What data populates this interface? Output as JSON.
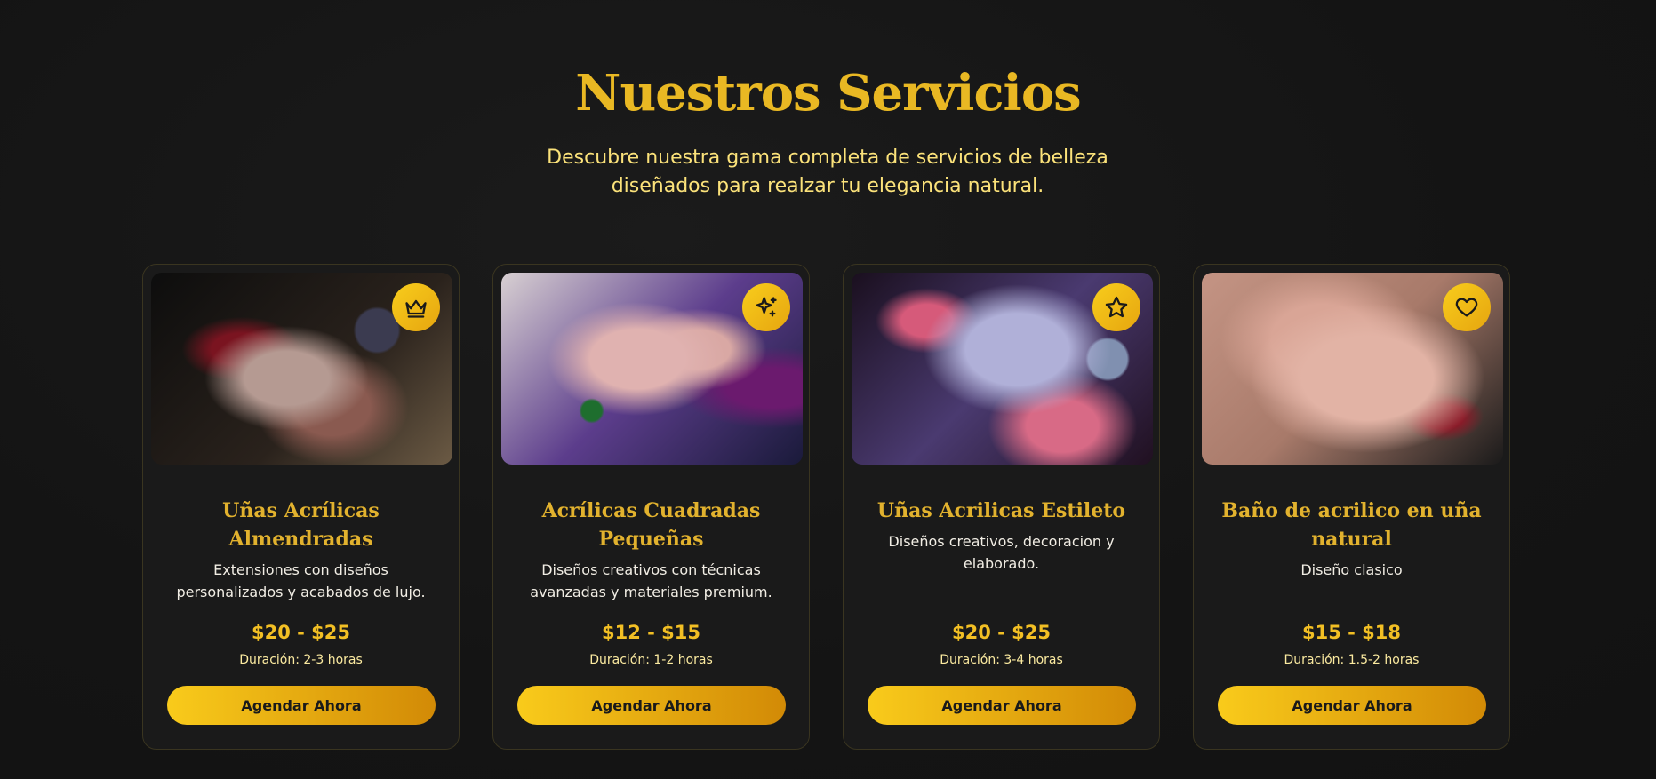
{
  "section": {
    "title": "Nuestros Servicios",
    "subtitle": "Descubre nuestra gama completa de servicios de belleza diseñados para realzar tu elegancia natural."
  },
  "services": [
    {
      "title": "Uñas Acrílicas Almendradas",
      "description": "Extensiones con diseños personalizados y acabados de lujo.",
      "price": "$20 - $25",
      "duration": "Duración: 2-3 horas",
      "button_label": "Agendar Ahora",
      "badge_icon": "crown-icon"
    },
    {
      "title": "Acrílicas Cuadradas Pequeñas",
      "description": "Diseños creativos con técnicas avanzadas y materiales premium.",
      "price": "$12 - $15",
      "duration": "Duración: 1-2 horas",
      "button_label": "Agendar Ahora",
      "badge_icon": "sparkles-icon"
    },
    {
      "title": "Uñas Acrilicas Estileto",
      "description": "Diseños creativos, decoracion y elaborado.",
      "price": "$20 - $25",
      "duration": "Duración: 3-4 horas",
      "button_label": "Agendar Ahora",
      "badge_icon": "star-icon"
    },
    {
      "title": "Baño de acrilico en uña natural",
      "description": "Diseño clasico",
      "price": "$15 - $18",
      "duration": "Duración: 1.5-2 horas",
      "button_label": "Agendar Ahora",
      "badge_icon": "heart-icon"
    }
  ],
  "colors": {
    "background": "#141414",
    "accent_gold": "#e9b823",
    "card_background": "#1a1a1a"
  }
}
